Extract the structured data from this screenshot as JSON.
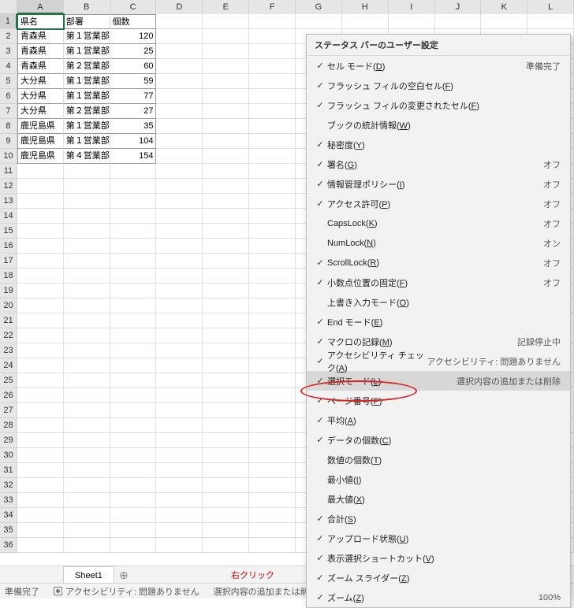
{
  "columns": [
    "A",
    "B",
    "C",
    "D",
    "E",
    "F",
    "G",
    "H",
    "I",
    "J",
    "K",
    "L"
  ],
  "rowCount": 36,
  "activeCell": {
    "row": 1,
    "col": 0
  },
  "table": {
    "headers": [
      "県名",
      "部署",
      "個数"
    ],
    "rows": [
      [
        "青森県",
        "第１営業部",
        "120"
      ],
      [
        "青森県",
        "第１営業部",
        "25"
      ],
      [
        "青森県",
        "第２営業部",
        "60"
      ],
      [
        "大分県",
        "第１営業部",
        "59"
      ],
      [
        "大分県",
        "第１営業部",
        "77"
      ],
      [
        "大分県",
        "第２営業部",
        "27"
      ],
      [
        "鹿児島県",
        "第１営業部",
        "35"
      ],
      [
        "鹿児島県",
        "第１営業部",
        "104"
      ],
      [
        "鹿児島県",
        "第４営業部",
        "154"
      ]
    ]
  },
  "sheetTab": "Sheet1",
  "annotation": "右クリック",
  "statusBar": {
    "ready": "準備完了",
    "accessibility": "アクセシビリティ: 問題ありません",
    "selection": "選択内容の追加または削除",
    "zoom": "100%"
  },
  "contextMenu": {
    "title": "ステータス バーのユーザー設定",
    "items": [
      {
        "check": true,
        "label": "セル モード",
        "accel": "D",
        "val": "準備完了"
      },
      {
        "check": true,
        "label": "フラッシュ フィルの空白セル",
        "accel": "F",
        "val": ""
      },
      {
        "check": true,
        "label": "フラッシュ フィルの変更されたセル",
        "accel": "F",
        "val": ""
      },
      {
        "check": false,
        "label": "ブックの統計情報",
        "accel": "W",
        "val": ""
      },
      {
        "check": true,
        "label": "秘密度",
        "accel": "Y",
        "val": ""
      },
      {
        "check": true,
        "label": "署名",
        "accel": "G",
        "val": "オフ"
      },
      {
        "check": true,
        "label": "情報管理ポリシー",
        "accel": "I",
        "val": "オフ"
      },
      {
        "check": true,
        "label": "アクセス許可",
        "accel": "P",
        "val": "オフ"
      },
      {
        "check": false,
        "label": "CapsLock",
        "accel": "K",
        "val": "オフ"
      },
      {
        "check": false,
        "label": "NumLock",
        "accel": "N",
        "val": "オン"
      },
      {
        "check": true,
        "label": "ScrollLock",
        "accel": "R",
        "val": "オフ"
      },
      {
        "check": true,
        "label": "小数点位置の固定",
        "accel": "F",
        "val": "オフ"
      },
      {
        "check": false,
        "label": "上書き入力モード",
        "accel": "O",
        "val": ""
      },
      {
        "check": true,
        "label": "End モード",
        "accel": "E",
        "val": ""
      },
      {
        "check": true,
        "label": "マクロの記録",
        "accel": "M",
        "val": "記録停止中"
      },
      {
        "check": true,
        "label": "アクセシビリティ チェック",
        "accel": "A",
        "val": "アクセシビリティ: 問題ありません"
      },
      {
        "check": true,
        "label": "選択モード",
        "accel": "L",
        "val": "選択内容の追加または削除",
        "hl": true
      },
      {
        "check": true,
        "label": "ページ番号",
        "accel": "P",
        "val": ""
      },
      {
        "check": true,
        "label": "平均",
        "accel": "A",
        "val": ""
      },
      {
        "check": true,
        "label": "データの個数",
        "accel": "C",
        "val": ""
      },
      {
        "check": false,
        "label": "数値の個数",
        "accel": "T",
        "val": ""
      },
      {
        "check": false,
        "label": "最小値",
        "accel": "I",
        "val": ""
      },
      {
        "check": false,
        "label": "最大値",
        "accel": "X",
        "val": ""
      },
      {
        "check": true,
        "label": "合計",
        "accel": "S",
        "val": ""
      },
      {
        "check": true,
        "label": "アップロード状態",
        "accel": "U",
        "val": ""
      },
      {
        "check": true,
        "label": "表示選択ショートカット",
        "accel": "V",
        "val": ""
      },
      {
        "check": true,
        "label": "ズーム スライダー",
        "accel": "Z",
        "val": ""
      },
      {
        "check": true,
        "label": "ズーム",
        "accel": "Z",
        "val": "100%"
      }
    ]
  }
}
